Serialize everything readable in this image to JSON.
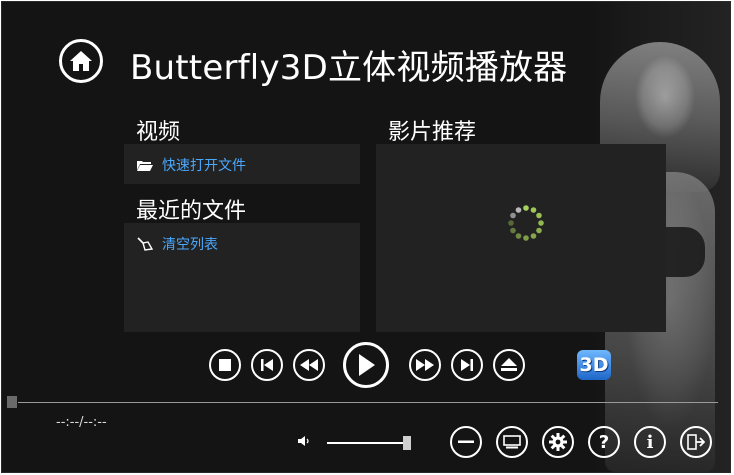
{
  "app": {
    "title": "Butterfly3D立体视频播放器"
  },
  "video_section": {
    "heading": "视频",
    "open_file_label": "快速打开文件"
  },
  "recent_section": {
    "heading": "最近的文件",
    "clear_list_label": "清空列表"
  },
  "recommend_section": {
    "heading": "影片推荐"
  },
  "player": {
    "badge_3d": "3D",
    "time_display": "--:--/--:--",
    "progress_percent": 0,
    "volume_percent": 100
  },
  "icons": {
    "home": "home-icon",
    "stop": "stop-icon",
    "previous": "previous-icon",
    "rewind": "rewind-icon",
    "play": "play-icon",
    "fast_forward": "fast-forward-icon",
    "next": "next-icon",
    "eject": "eject-icon",
    "volume": "volume-icon",
    "minimize": "minimize-icon",
    "screen": "screen-icon",
    "settings": "gear-icon",
    "help": "help-icon",
    "info": "info-icon",
    "exit": "exit-icon"
  },
  "bottom_buttons": {
    "help_glyph": "?",
    "info_glyph": "i"
  },
  "colors": {
    "background": "#141414",
    "panel": "#222222",
    "link": "#4aa8ff",
    "accent_3d": "#1e66c8",
    "spinner": "#a6d15a"
  }
}
